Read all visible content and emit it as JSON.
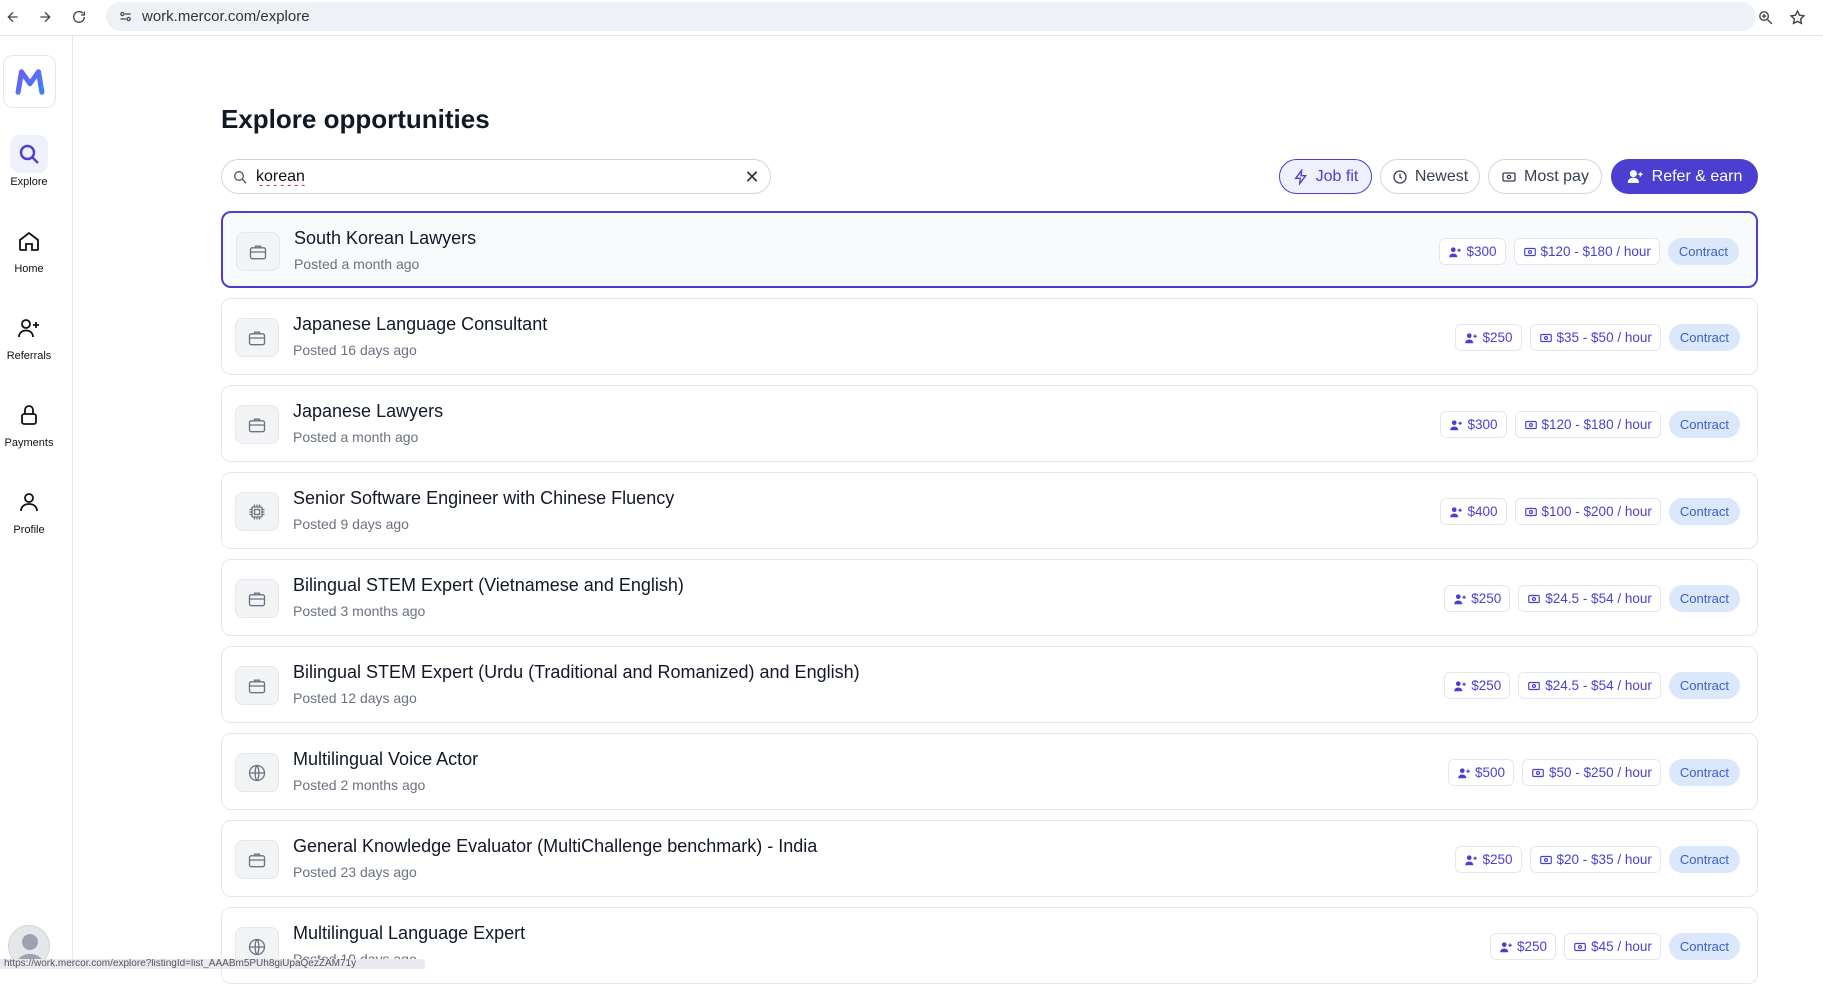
{
  "browser": {
    "url": "work.mercor.com/explore",
    "status_url": "https://work.mercor.com/explore?listingId=list_AAABm5PUh8giUpaQezZAM71y"
  },
  "sidebar": {
    "items": [
      {
        "label": "Explore",
        "icon": "search-icon"
      },
      {
        "label": "Home",
        "icon": "home-icon"
      },
      {
        "label": "Referrals",
        "icon": "user-plus-icon"
      },
      {
        "label": "Payments",
        "icon": "lock-icon"
      },
      {
        "label": "Profile",
        "icon": "user-icon"
      }
    ]
  },
  "main": {
    "title": "Explore opportunities",
    "search": {
      "value": "korean",
      "placeholder": ""
    },
    "sort": {
      "job_fit": "Job fit",
      "newest": "Newest",
      "most_pay": "Most pay"
    },
    "refer_label": "Refer & earn"
  },
  "jobs": [
    {
      "title": "South Korean Lawyers",
      "posted": "Posted a month ago",
      "referral": "$300",
      "pay": "$120 - $180 / hour",
      "type": "Contract",
      "icon": "briefcase-icon"
    },
    {
      "title": "Japanese Language Consultant",
      "posted": "Posted 16 days ago",
      "referral": "$250",
      "pay": "$35 - $50 / hour",
      "type": "Contract",
      "icon": "briefcase-icon"
    },
    {
      "title": "Japanese Lawyers",
      "posted": "Posted a month ago",
      "referral": "$300",
      "pay": "$120 - $180 / hour",
      "type": "Contract",
      "icon": "briefcase-icon"
    },
    {
      "title": "Senior Software Engineer with Chinese Fluency",
      "posted": "Posted 9 days ago",
      "referral": "$400",
      "pay": "$100 - $200 / hour",
      "type": "Contract",
      "icon": "chip-icon"
    },
    {
      "title": "Bilingual STEM Expert (Vietnamese and English)",
      "posted": "Posted 3 months ago",
      "referral": "$250",
      "pay": "$24.5 - $54 / hour",
      "type": "Contract",
      "icon": "briefcase-icon"
    },
    {
      "title": "Bilingual STEM Expert (Urdu (Traditional and Romanized) and English)",
      "posted": "Posted 12 days ago",
      "referral": "$250",
      "pay": "$24.5 - $54 / hour",
      "type": "Contract",
      "icon": "briefcase-icon"
    },
    {
      "title": "Multilingual Voice Actor",
      "posted": "Posted 2 months ago",
      "referral": "$500",
      "pay": "$50 - $250 / hour",
      "type": "Contract",
      "icon": "globe-icon"
    },
    {
      "title": "General Knowledge Evaluator (MultiChallenge benchmark) - India",
      "posted": "Posted 23 days ago",
      "referral": "$250",
      "pay": "$20 - $35 / hour",
      "type": "Contract",
      "icon": "briefcase-icon"
    },
    {
      "title": "Multilingual Language Expert",
      "posted": "Posted 19 days ago",
      "referral": "$250",
      "pay": "$45 / hour",
      "type": "Contract",
      "icon": "globe-icon"
    }
  ]
}
